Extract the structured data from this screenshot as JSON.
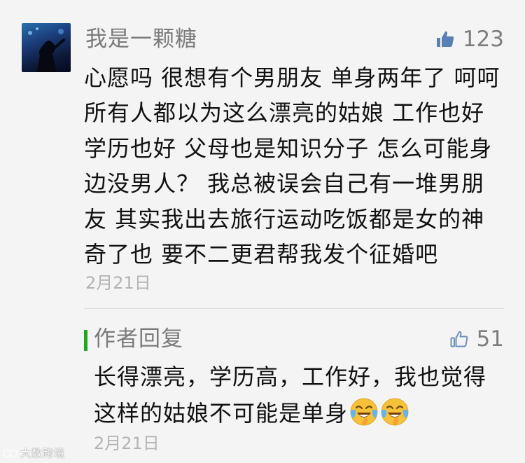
{
  "comment": {
    "nickname": "我是一颗糖",
    "like_count": "123",
    "content": "心愿吗 很想有个男朋友  单身两年了 呵呵 所有人都以为这么漂亮的姑娘 工作也好学历也好 父母也是知识分子 怎么可能身边没男人？ 我总被误会自己有一堆男朋友 其实我出去旅行运动吃饭都是女的神奇了也 要不二更君帮我发个征婚吧",
    "date": "2月21日"
  },
  "reply": {
    "label": "作者回复",
    "like_count": "51",
    "content": "长得漂亮，学历高，工作好，我也觉得这样的姑娘不可能是单身",
    "emojis": [
      "laughing-tears-emoji",
      "laughing-tears-emoji"
    ],
    "date": "2月21日"
  },
  "watermark": {
    "text": "大数跨境"
  },
  "colors": {
    "background": "#f4f4f4",
    "reply_accent": "#1aad19",
    "meta_text": "#7a7a7a",
    "date_text": "#b3b3b3",
    "thumb_filled": "#5a7fb2",
    "thumb_outline": "#6f8fbd"
  }
}
